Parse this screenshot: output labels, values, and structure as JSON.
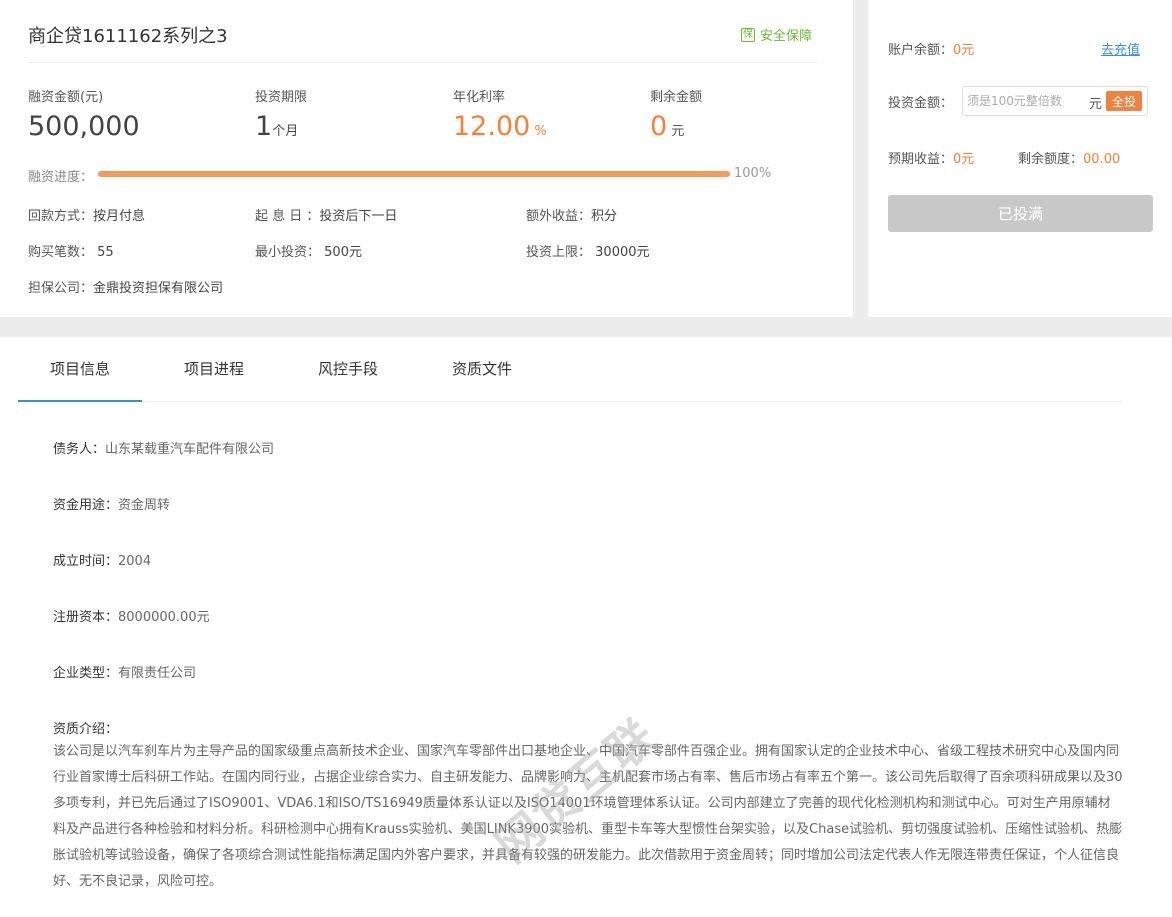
{
  "product": {
    "title": "商企贷1611162系列之3",
    "safe_label": "安全保障",
    "safe_icon_text": "保"
  },
  "stats": [
    {
      "label": "融资金额(元)",
      "value": "500,000",
      "unit": ""
    },
    {
      "label": "投资期限",
      "value": "1",
      "unit": "个月"
    },
    {
      "label": "年化利率",
      "value": "12.00",
      "unit": " %"
    },
    {
      "label": "剩余金额",
      "value": "0",
      "unit": " 元"
    }
  ],
  "progress": {
    "label": "融资进度：",
    "percent": 100,
    "percent_text": "100%"
  },
  "info": {
    "repay_label": "回款方式：",
    "repay_value": "按月付息",
    "interest_label": "起 息 日 ：",
    "interest_value": "投资后下一日",
    "extra_label": "额外收益：",
    "extra_value": "积分",
    "count_label": "购买笔数：",
    "count_value": " 55",
    "min_label": "最小投资：",
    "min_value": " 500元",
    "max_label": "投资上限：",
    "max_value": " 30000元",
    "guarantor_label": "担保公司：",
    "guarantor_value": "金鼎投资担保有限公司"
  },
  "account": {
    "balance_label": "账户余额：",
    "balance_value": "0元",
    "recharge": "去充值",
    "invest_label": "投资金额：",
    "invest_placeholder": "须是100元整倍数",
    "yuan": "元",
    "all_in": "全投",
    "expected_label": "预期收益：",
    "expected_value": "0元",
    "remaining_label": "剩余额度：",
    "remaining_value": "00.00",
    "full_button": "已投满"
  },
  "tabs": [
    "项目信息",
    "项目进程",
    "风控手段",
    "资质文件"
  ],
  "details": {
    "debtor_label": "债务人：",
    "debtor_value": "山东某载重汽车配件有限公司",
    "usage_label": "资金用途：",
    "usage_value": "资金周转",
    "founded_label": "成立时间：",
    "founded_value": "2004",
    "capital_label": "注册资本：",
    "capital_value": "8000000.00元",
    "type_label": "企业类型：",
    "type_value": "有限责任公司",
    "intro_label": "资质介绍：",
    "intro_text": "该公司是以汽车刹车片为主导产品的国家级重点高新技术企业、国家汽车零部件出口基地企业、中国汽车零部件百强企业。拥有国家认定的企业技术中心、省级工程技术研究中心及国内同行业首家博士后科研工作站。在国内同行业，占据企业综合实力、自主研发能力、品牌影响力、主机配套市场占有率、售后市场占有率五个第一。该公司先后取得了百余项科研成果以及30多项专利，并已先后通过了ISO9001、VDA6.1和ISO/TS16949质量体系认证以及ISO14001环境管理体系认证。公司内部建立了完善的现代化检测机构和测试中心。可对生产用原辅材料及产品进行各种检验和材料分析。科研检测中心拥有Krauss实验机、美国LINK3900实验机、重型卡车等大型惯性台架实验，以及Chase试验机、剪切强度试验机、压缩性试验机、热膨胀试验机等试验设备，确保了各项综合测试性能指标满足国内外客户要求，并具备有较强的研发能力。此次借款用于资金周转；同时增加公司法定代表人作无限连带责任保证，个人征信良好、无不良记录，风险可控。"
  },
  "watermark": "网贷互联"
}
